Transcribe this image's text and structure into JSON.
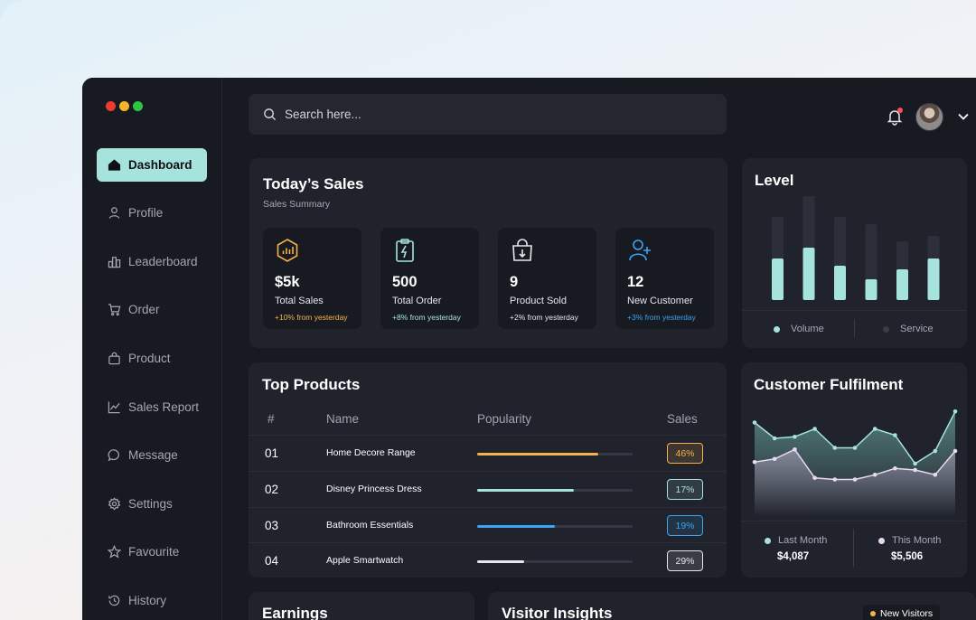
{
  "window": {
    "dot_colors": [
      "#ee3b2f",
      "#f6b428",
      "#30c443"
    ]
  },
  "sidebar": {
    "items": [
      {
        "label": "Dashboard",
        "icon": "home-icon",
        "active": true
      },
      {
        "label": "Profile",
        "icon": "user-icon",
        "active": false
      },
      {
        "label": "Leaderboard",
        "icon": "leaderboard-icon",
        "active": false
      },
      {
        "label": "Order",
        "icon": "cart-icon",
        "active": false
      },
      {
        "label": "Product",
        "icon": "bag-icon",
        "active": false
      },
      {
        "label": "Sales Report",
        "icon": "line-chart-icon",
        "active": false
      },
      {
        "label": "Message",
        "icon": "message-icon",
        "active": false
      },
      {
        "label": "Settings",
        "icon": "gear-icon",
        "active": false
      },
      {
        "label": "Favourite",
        "icon": "star-icon",
        "active": false
      },
      {
        "label": "History",
        "icon": "history-icon",
        "active": false
      }
    ]
  },
  "header": {
    "search_placeholder": "Search here..."
  },
  "todays_sales": {
    "title": "Today’s Sales",
    "subtitle": "Sales Summary",
    "stats": [
      {
        "value": "$5k",
        "label": "Total Sales",
        "delta": "+10% from yesterday",
        "color": "#f6b14b",
        "icon": "sales-icon"
      },
      {
        "value": "500",
        "label": "Total Order",
        "delta": "+8% from yesterday",
        "color": "#a6e3dc",
        "icon": "clipboard-icon"
      },
      {
        "value": "9",
        "label": "Product Sold",
        "delta": "+2% from yesterday",
        "color": "#e6e7ec",
        "icon": "shopping-bag-icon"
      },
      {
        "value": "12",
        "label": "New Customer",
        "delta": "+3% from yesterday",
        "color": "#3aa5f0",
        "icon": "add-user-icon"
      }
    ]
  },
  "level": {
    "title": "Level",
    "legend": [
      "Volume",
      "Service"
    ],
    "colors": {
      "volume": "#a6e3dc",
      "service": "#2c2e39"
    },
    "chart_data": {
      "type": "bar",
      "series": [
        {
          "name": "Volume",
          "values": [
            46,
            58,
            38,
            23,
            34,
            46
          ]
        },
        {
          "name": "Service",
          "values": [
            92,
            115,
            92,
            84,
            65,
            71
          ]
        }
      ]
    }
  },
  "top_products": {
    "title": "Top Products",
    "headers": [
      "#",
      "Name",
      "Popularity",
      "Sales"
    ],
    "rows": [
      {
        "num": "01",
        "name": "Home Decore Range",
        "popularity": 0.78,
        "sales": "46%",
        "color": "#f6b14b"
      },
      {
        "num": "02",
        "name": "Disney Princess Dress",
        "popularity": 0.62,
        "sales": "17%",
        "color": "#a6e3dc"
      },
      {
        "num": "03",
        "name": "Bathroom Essentials",
        "popularity": 0.5,
        "sales": "19%",
        "color": "#3aa5f0"
      },
      {
        "num": "04",
        "name": "Apple Smartwatch",
        "popularity": 0.3,
        "sales": "29%",
        "color": "#e6e7ec"
      }
    ]
  },
  "customer_fulfilment": {
    "title": "Customer Fulfilment",
    "last_month": {
      "label": "Last Month",
      "value": "$4,087",
      "color": "#a6e3dc"
    },
    "this_month": {
      "label": "This Month",
      "value": "$5,506",
      "color": "#e9d9f0"
    },
    "chart_data": {
      "type": "area",
      "series": [
        {
          "name": "Last Month",
          "values": [
            58,
            48,
            49,
            54,
            42,
            42,
            54,
            50,
            32,
            40,
            65
          ]
        },
        {
          "name": "This Month",
          "values": [
            33,
            35,
            41,
            23,
            22,
            22,
            25,
            29,
            28,
            25,
            40
          ]
        }
      ]
    }
  },
  "earnings": {
    "title": "Earnings"
  },
  "visitor_insights": {
    "title": "Visitor Insights",
    "legend": "New Visitors",
    "legend_color": "#f6b14b"
  }
}
